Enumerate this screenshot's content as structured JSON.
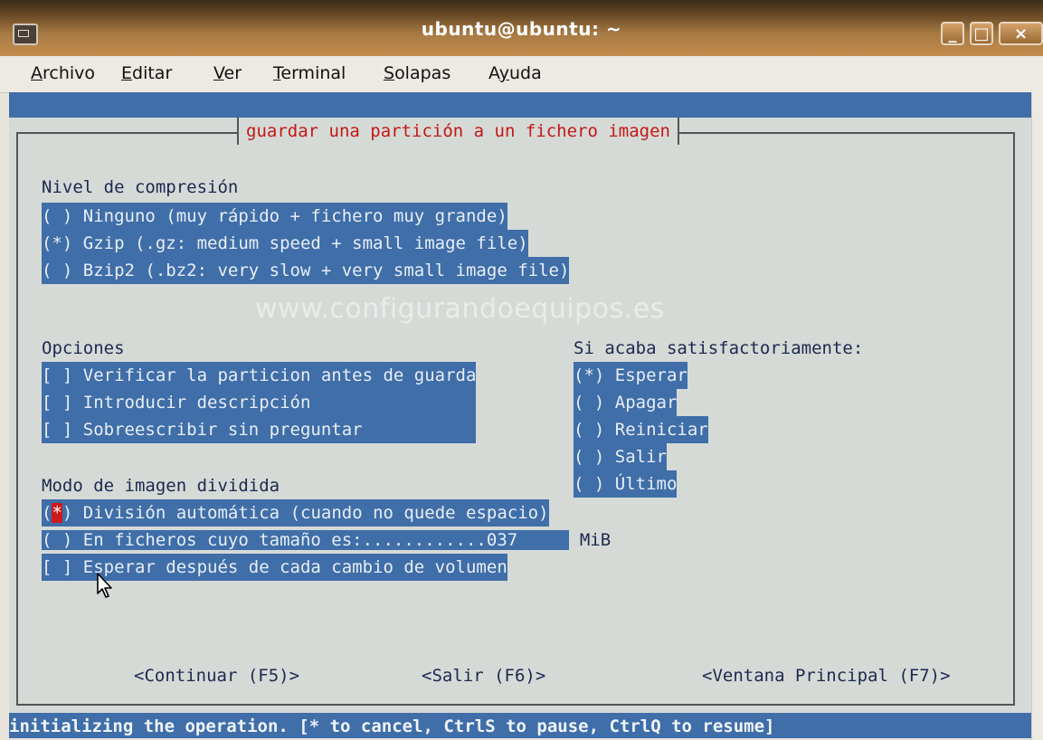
{
  "window": {
    "title": "ubuntu@ubuntu: ~",
    "buttons": {
      "minimize": "_",
      "maximize": "□",
      "close": "×"
    }
  },
  "menu": {
    "items": [
      {
        "pre": "",
        "u": "A",
        "post": "rchivo"
      },
      {
        "pre": "",
        "u": "E",
        "post": "ditar"
      },
      {
        "pre": "",
        "u": "V",
        "post": "er"
      },
      {
        "pre": "",
        "u": "T",
        "post": "erminal"
      },
      {
        "pre": "",
        "u": "S",
        "post": "olapas"
      },
      {
        "pre": "A",
        "u": "y",
        "post": "uda"
      }
    ]
  },
  "dialog": {
    "title": "guardar una partición a un fichero imagen",
    "compression": {
      "heading": "Nivel de compresión",
      "options": [
        "( ) Ninguno (muy rápido + fichero muy grande)",
        "(*) Gzip (.gz: medium speed + small image file)",
        "( ) Bzip2 (.bz2: very slow + very small image file)"
      ]
    },
    "watermark": "www.configurandoequipos.es",
    "options": {
      "heading": "Opciones",
      "items": [
        "[ ] Verificar la particion antes de guarda",
        "[ ] Introducir descripción                ",
        "[ ] Sobreescribir sin preguntar           "
      ]
    },
    "on_success": {
      "heading": "Si acaba satisfactoriamente:",
      "items": [
        "(*) Esperar",
        "( ) Apagar",
        "( ) Reiniciar",
        "( ) Salir",
        "( ) Último"
      ]
    },
    "split": {
      "heading": "Modo de imagen dividida",
      "auto_mark_open": "(",
      "auto_mark": "*",
      "auto_rest": ") División automática (cuando no quede espacio)",
      "size_label": "( ) En ficheros cuyo tamaño es:............037     ",
      "size_unit": "MiB",
      "wait": "[ ] Esperar después de cada cambio de volumen"
    },
    "buttons": {
      "continue": "<Continuar (F5)>",
      "exit": "<Salir (F6)>",
      "main": "<Ventana Principal (F7)>"
    }
  },
  "status_bar": "initializing the operation. [* to cancel, CtrlS to pause, CtrlQ to resume]"
}
